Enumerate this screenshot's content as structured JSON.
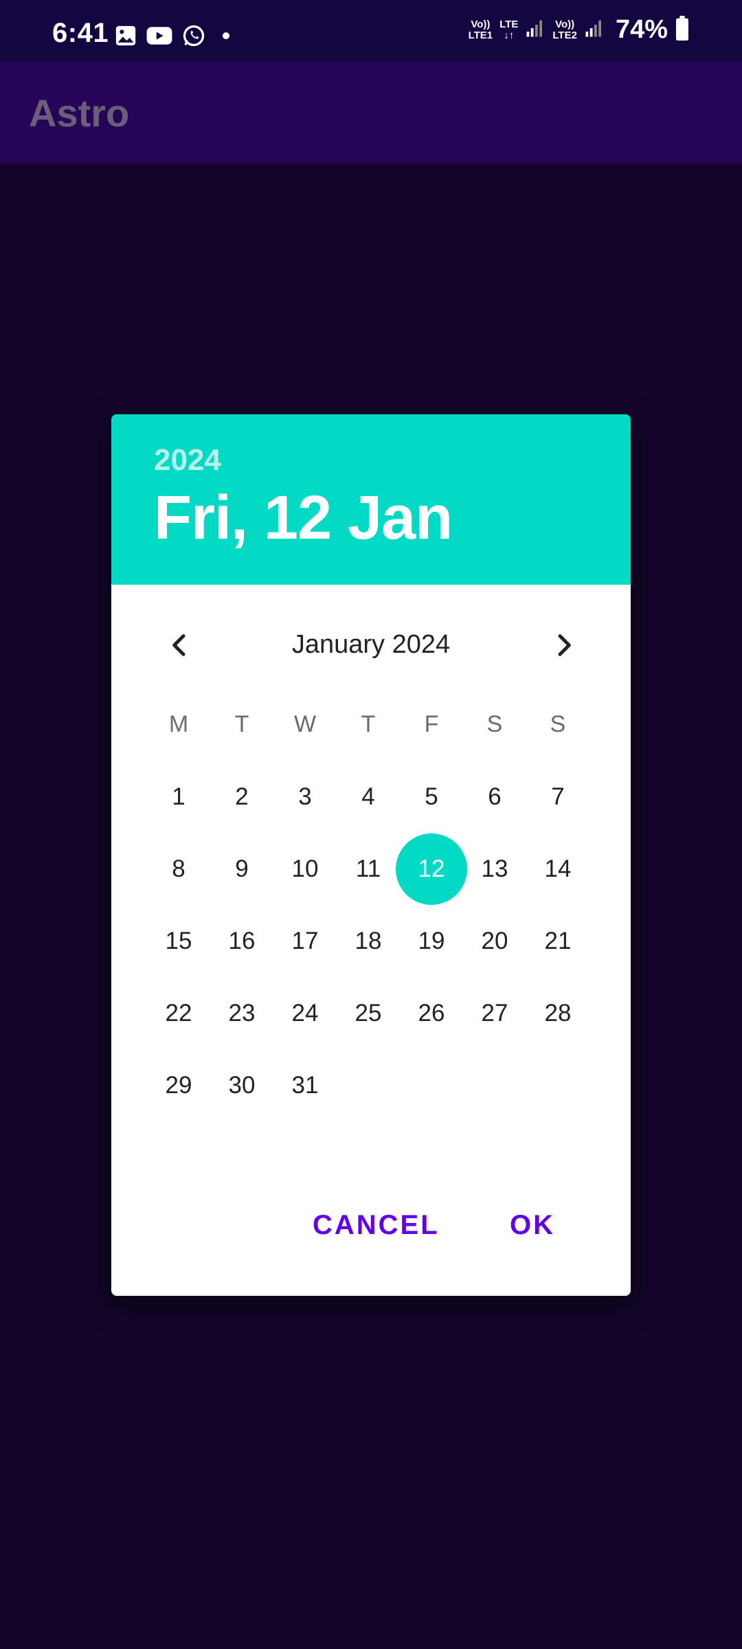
{
  "status_bar": {
    "time": "6:41",
    "icons": [
      "gallery-icon",
      "youtube-icon",
      "whatsapp-icon",
      "notification-dot"
    ],
    "sim1_label_top": "Vo))",
    "sim1_label_bottom": "LTE1",
    "lte_label_top": "LTE",
    "lte_label_bottom": "↓↑",
    "sim2_label_top": "Vo))",
    "sim2_label_bottom": "LTE2",
    "battery_percent": "74%"
  },
  "app_bar": {
    "title": "Astro"
  },
  "dialog": {
    "header": {
      "year": "2024",
      "selected_date": "Fri, 12 Jan"
    },
    "month_label": "January 2024",
    "weekdays": [
      "M",
      "T",
      "W",
      "T",
      "F",
      "S",
      "S"
    ],
    "days": [
      "1",
      "2",
      "3",
      "4",
      "5",
      "6",
      "7",
      "8",
      "9",
      "10",
      "11",
      "12",
      "13",
      "14",
      "15",
      "16",
      "17",
      "18",
      "19",
      "20",
      "21",
      "22",
      "23",
      "24",
      "25",
      "26",
      "27",
      "28",
      "29",
      "30",
      "31"
    ],
    "first_day_column": 0,
    "selected_day": "12",
    "actions": {
      "cancel_label": "CANCEL",
      "ok_label": "OK"
    }
  },
  "colors": {
    "accent": "#03dac5",
    "primary": "#6200ee",
    "app_bar": "#260458",
    "background": "#14062a"
  }
}
